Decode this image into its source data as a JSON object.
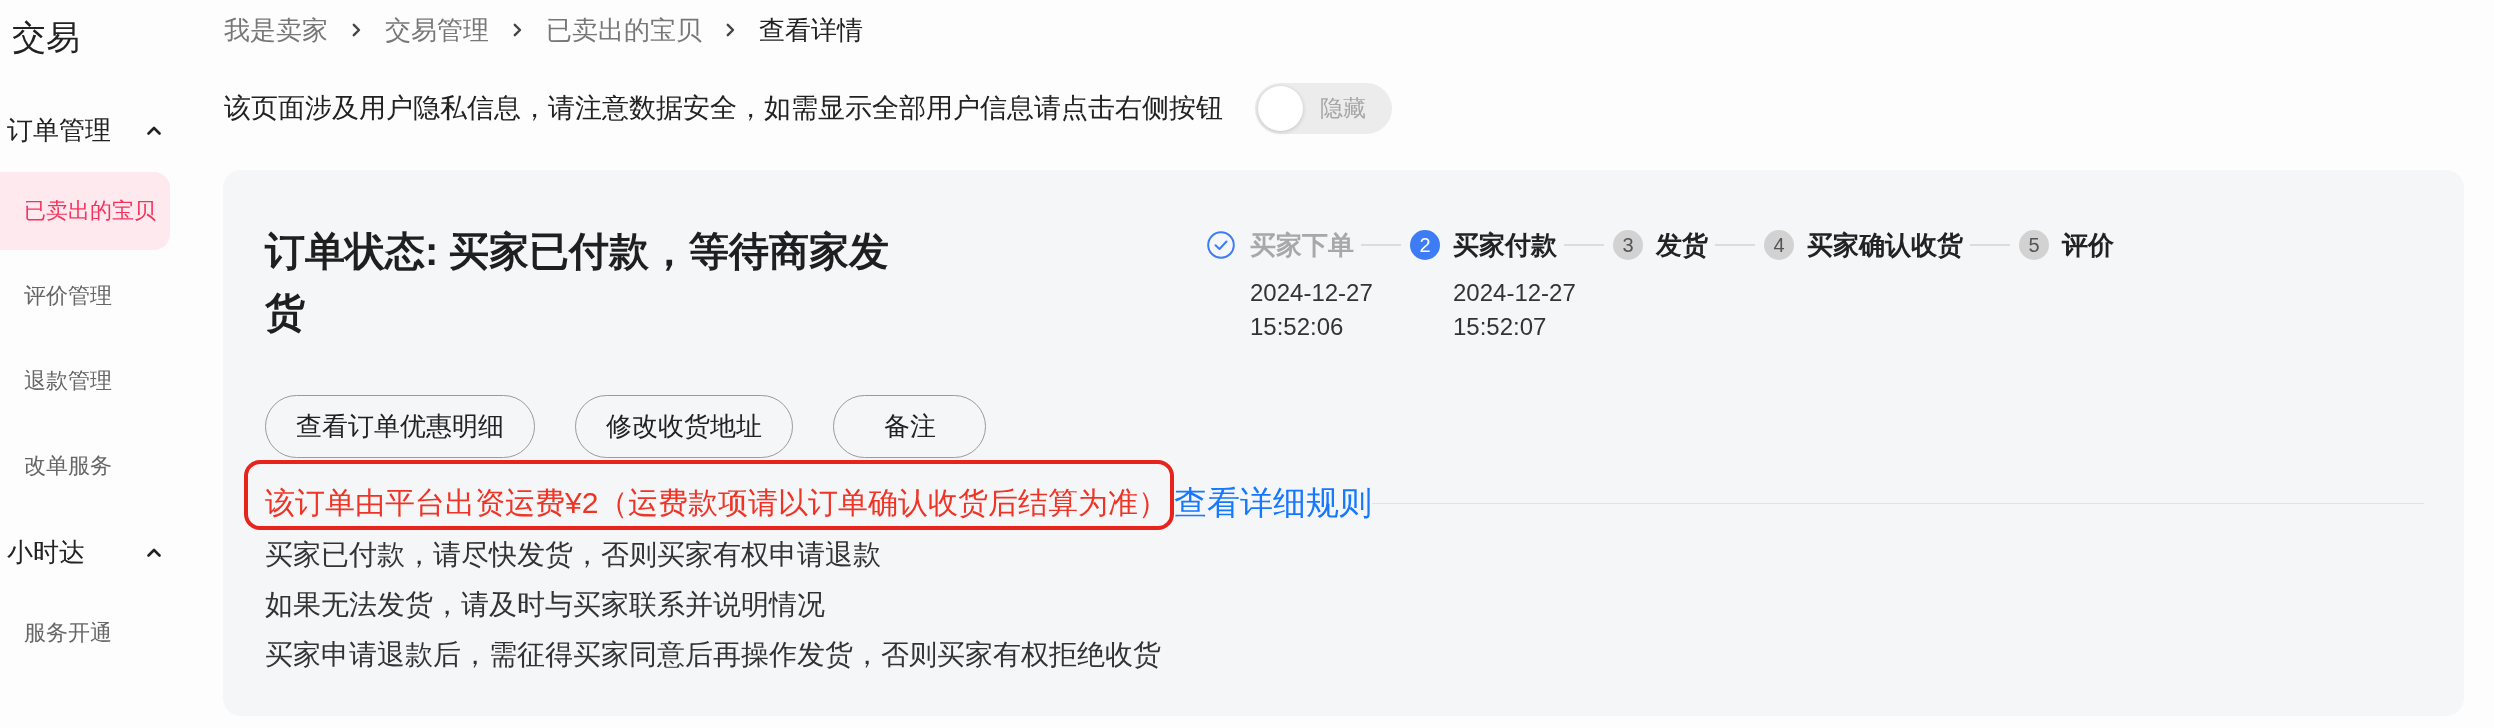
{
  "sidebar": {
    "title": "交易",
    "sections": [
      {
        "title": "订单管理",
        "expanded": true,
        "items": [
          {
            "label": "已卖出的宝贝",
            "selected": true
          },
          {
            "label": "评价管理",
            "selected": false
          },
          {
            "label": "退款管理",
            "selected": false
          },
          {
            "label": "改单服务",
            "selected": false
          }
        ]
      },
      {
        "title": "小时达",
        "expanded": true,
        "items": [
          {
            "label": "服务开通",
            "selected": false
          }
        ]
      }
    ]
  },
  "breadcrumb": [
    {
      "label": "我是卖家",
      "current": false
    },
    {
      "label": "交易管理",
      "current": false
    },
    {
      "label": "已卖出的宝贝",
      "current": false
    },
    {
      "label": "查看详情",
      "current": true
    }
  ],
  "privacy": {
    "text": "该页面涉及用户隐私信息，请注意数据安全，如需显示全部用户信息请点击右侧按钮",
    "toggle": {
      "label": "隐藏",
      "on": false
    }
  },
  "order": {
    "status_title": "订单状态: 买家已付款，等待商家发货",
    "steps": [
      {
        "label": "买家下单",
        "done": true,
        "selected": false,
        "date": "2024-12-27",
        "time": "15:52:06"
      },
      {
        "number": "2",
        "label": "买家付款",
        "done": false,
        "selected": true,
        "date": "2024-12-27",
        "time": "15:52:07"
      },
      {
        "number": "3",
        "label": "发货",
        "done": false,
        "selected": false
      },
      {
        "number": "4",
        "label": "买家确认收货",
        "done": false,
        "selected": false
      },
      {
        "number": "5",
        "label": "评价",
        "done": false,
        "selected": false
      }
    ],
    "actions": [
      "查看订单优惠明细",
      "修改收货地址",
      "备注"
    ],
    "fee_notice": {
      "text": "该订单由平台出资运费¥2（运费款项请以订单确认收货后结算为准）",
      "link": "查看详细规则",
      "highlighted": true
    },
    "tips": [
      "买家已付款，请尽快发货，否则买家有权申请退款",
      "如果无法发货，请及时与买家联系并说明情况",
      "买家申请退款后，需征得买家同意后再操作发货，否则买家有权拒绝收货"
    ]
  }
}
